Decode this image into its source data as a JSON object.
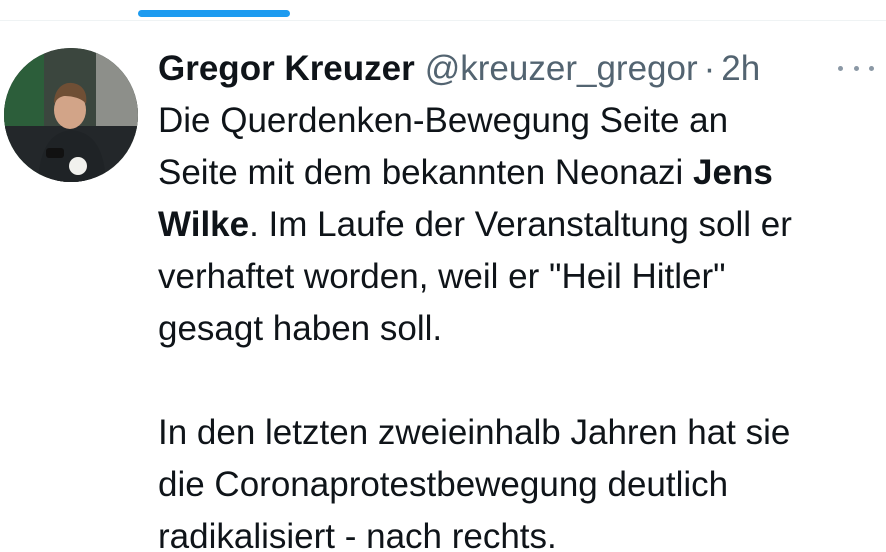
{
  "tweet": {
    "author": {
      "display_name": "Gregor Kreuzer",
      "handle": "@kreuzer_gregor",
      "separator": "·",
      "time": "2h",
      "avatar_icon": "profile-photo"
    },
    "more_icon": "ellipsis-icon",
    "paragraphs": [
      {
        "lines": [
          [
            {
              "text": "Die Querdenken-Bewegung Seite an",
              "bold": false
            }
          ],
          [
            {
              "text": "Seite mit dem bekannten Neonazi ",
              "bold": false
            },
            {
              "text": "Jens",
              "bold": true
            }
          ],
          [
            {
              "text": "Wilke",
              "bold": true
            },
            {
              "text": ". Im Laufe der Veranstaltung soll er",
              "bold": false
            }
          ],
          [
            {
              "text": "verhaftet worden, weil er \"Heil Hitler\"",
              "bold": false
            }
          ],
          [
            {
              "text": "gesagt haben soll.",
              "bold": false
            }
          ]
        ]
      },
      {
        "lines": [
          [
            {
              "text": "In den letzten zweieinhalb Jahren hat sie",
              "bold": false
            }
          ],
          [
            {
              "text": "die Coronaprotestbewegung deutlich",
              "bold": false
            }
          ],
          [
            {
              "text": "radikalisiert - nach rechts.",
              "bold": false
            }
          ]
        ]
      }
    ]
  },
  "colors": {
    "accent": "#1d9bf0",
    "text_primary": "#0f1419",
    "text_secondary": "#536471"
  }
}
